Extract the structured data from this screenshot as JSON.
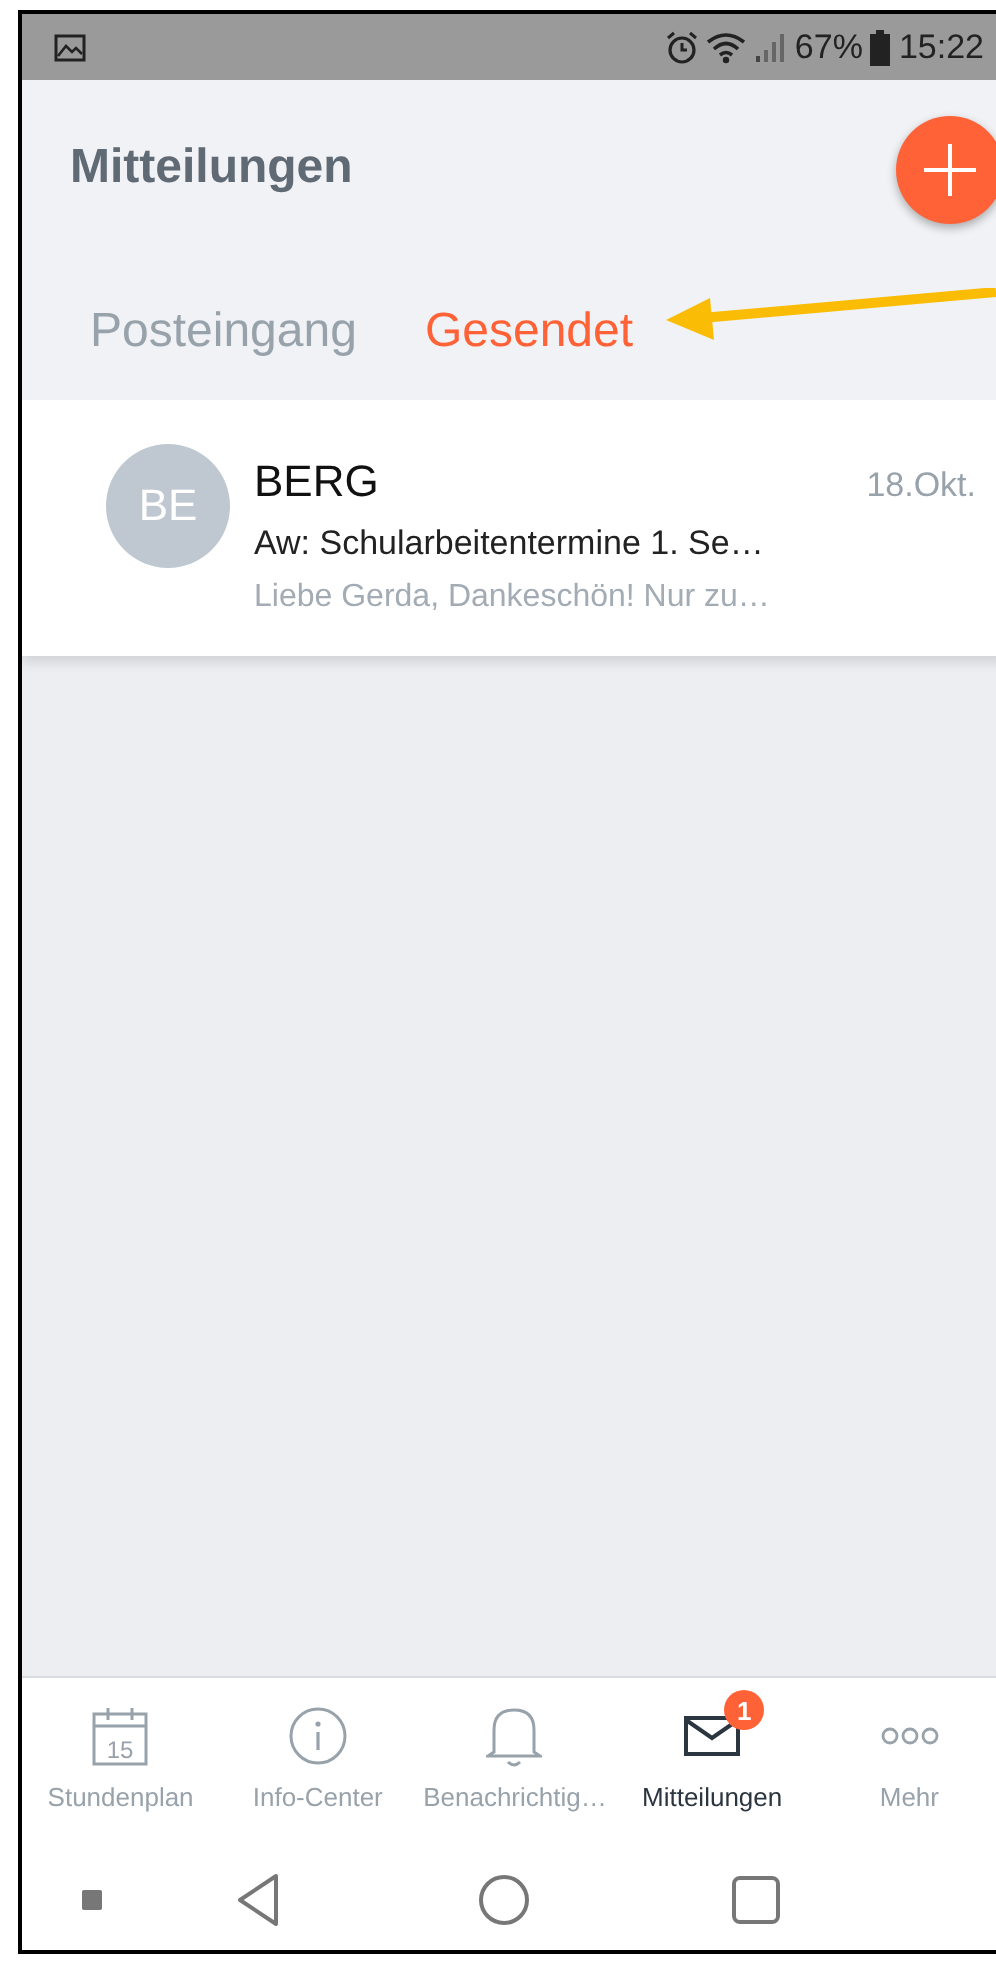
{
  "status_bar": {
    "battery": "67%",
    "time": "15:22"
  },
  "header": {
    "title": "Mitteilungen",
    "tabs": [
      {
        "label": "Posteingang",
        "selected": false
      },
      {
        "label": "Gesendet",
        "selected": true
      }
    ]
  },
  "messages": [
    {
      "avatar": "BE",
      "sender": "BERG",
      "date": "18.Okt.",
      "subject": "Aw: Schularbeitentermine 1. Se…",
      "preview": "Liebe Gerda, Dankeschön! Nur zu…"
    }
  ],
  "bottom_nav": [
    {
      "kind": "calendar",
      "icon_text": "15",
      "label": "Stundenplan",
      "selected": false
    },
    {
      "kind": "info",
      "label": "Info-Center",
      "selected": false
    },
    {
      "kind": "bell",
      "label": "Benachrichtig…",
      "selected": false
    },
    {
      "kind": "mail",
      "label": "Mitteilungen",
      "selected": true,
      "badge": "1"
    },
    {
      "kind": "more",
      "label": "Mehr",
      "selected": false
    }
  ]
}
